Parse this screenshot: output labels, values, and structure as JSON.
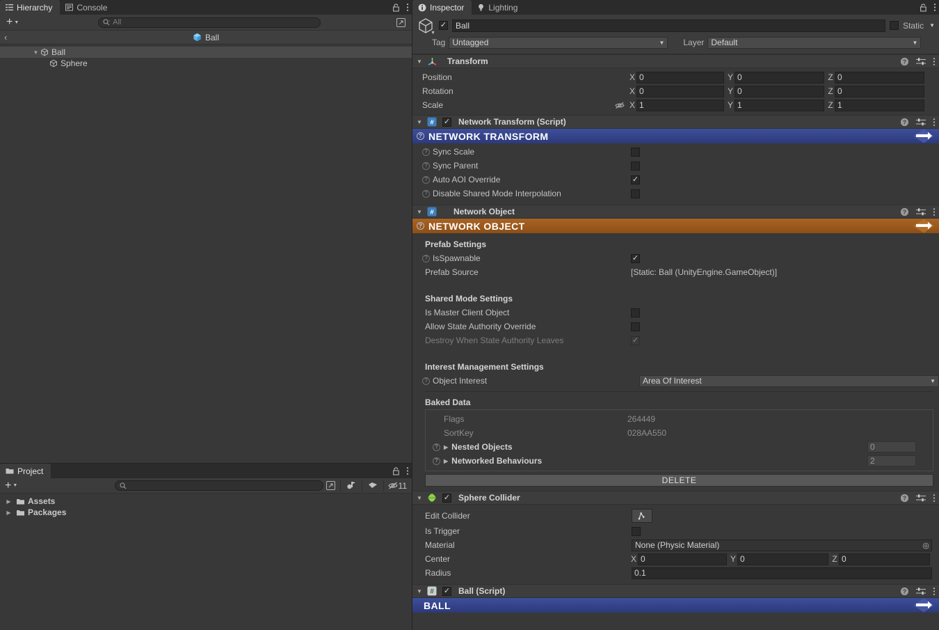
{
  "hierarchy": {
    "tabs": [
      {
        "label": "Hierarchy",
        "icon": "hierarchy-icon",
        "active": true
      },
      {
        "label": "Console",
        "icon": "console-icon",
        "active": false
      }
    ],
    "add_label": "+",
    "search_placeholder": "All",
    "breadcrumb": "Ball",
    "tree": [
      {
        "label": "Ball",
        "depth": 1,
        "expanded": true,
        "selected": true
      },
      {
        "label": "Sphere",
        "depth": 2,
        "expanded": false,
        "selected": false
      }
    ]
  },
  "project": {
    "tabs": [
      {
        "label": "Project",
        "icon": "folder-icon",
        "active": true
      }
    ],
    "add_label": "+",
    "search_placeholder": "",
    "hidden_count": "11",
    "rows": [
      {
        "label": "Assets"
      },
      {
        "label": "Packages"
      }
    ]
  },
  "inspector": {
    "tabs": [
      {
        "label": "Inspector",
        "icon": "info-icon",
        "active": true
      },
      {
        "label": "Lighting",
        "icon": "light-icon",
        "active": false
      }
    ],
    "gameobject": {
      "enabled": true,
      "name": "Ball",
      "static_label": "Static",
      "static_checked": false,
      "tag_label": "Tag",
      "tag_value": "Untagged",
      "layer_label": "Layer",
      "layer_value": "Default"
    },
    "transform": {
      "title": "Transform",
      "rows": [
        {
          "label": "Position",
          "x": "0",
          "y": "0",
          "z": "0",
          "hidden_icon": false
        },
        {
          "label": "Rotation",
          "x": "0",
          "y": "0",
          "z": "0",
          "hidden_icon": false
        },
        {
          "label": "Scale",
          "x": "1",
          "y": "1",
          "z": "1",
          "hidden_icon": true
        }
      ],
      "axes": [
        "X",
        "Y",
        "Z"
      ]
    },
    "network_transform": {
      "title": "Network Transform (Script)",
      "enabled": true,
      "banner": "NETWORK TRANSFORM",
      "banner_color": "#3d4e9b",
      "fields": [
        {
          "label": "Sync Scale",
          "checked": false
        },
        {
          "label": "Sync Parent",
          "checked": false
        },
        {
          "label": "Auto AOI Override",
          "checked": true
        },
        {
          "label": "Disable Shared Mode Interpolation",
          "checked": false
        }
      ]
    },
    "network_object": {
      "title": "Network Object",
      "banner": "NETWORK OBJECT",
      "banner_color": "#a96424",
      "prefab_settings_title": "Prefab Settings",
      "is_spawnable_label": "IsSpawnable",
      "is_spawnable_checked": true,
      "prefab_source_label": "Prefab Source",
      "prefab_source_value": "[Static: Ball (UnityEngine.GameObject)]",
      "shared_mode_title": "Shared Mode Settings",
      "shared_fields": [
        {
          "label": "Is Master Client Object",
          "checked": false,
          "disabled": false
        },
        {
          "label": "Allow State Authority Override",
          "checked": false,
          "disabled": false
        },
        {
          "label": "Destroy When State Authority Leaves",
          "checked": true,
          "disabled": true
        }
      ],
      "interest_title": "Interest Management Settings",
      "object_interest_label": "Object Interest",
      "object_interest_value": "Area Of Interest",
      "baked_data_title": "Baked Data",
      "baked_rows": [
        {
          "label": "Flags",
          "value": "264449"
        },
        {
          "label": "SortKey",
          "value": "028AA550"
        }
      ],
      "baked_lists": [
        {
          "label": "Nested Objects",
          "count": "0"
        },
        {
          "label": "Networked Behaviours",
          "count": "2"
        }
      ],
      "delete_label": "DELETE"
    },
    "sphere_collider": {
      "title": "Sphere Collider",
      "enabled": true,
      "edit_collider_label": "Edit Collider",
      "is_trigger_label": "Is Trigger",
      "is_trigger_checked": false,
      "material_label": "Material",
      "material_value": "None (Physic Material)",
      "center_label": "Center",
      "center": {
        "x": "0",
        "y": "0",
        "z": "0"
      },
      "radius_label": "Radius",
      "radius": "0.1",
      "axes": [
        "X",
        "Y",
        "Z"
      ]
    },
    "ball_script": {
      "title": "Ball (Script)",
      "enabled": true,
      "banner": "BALL",
      "banner_color": "#3d4e9b"
    }
  }
}
